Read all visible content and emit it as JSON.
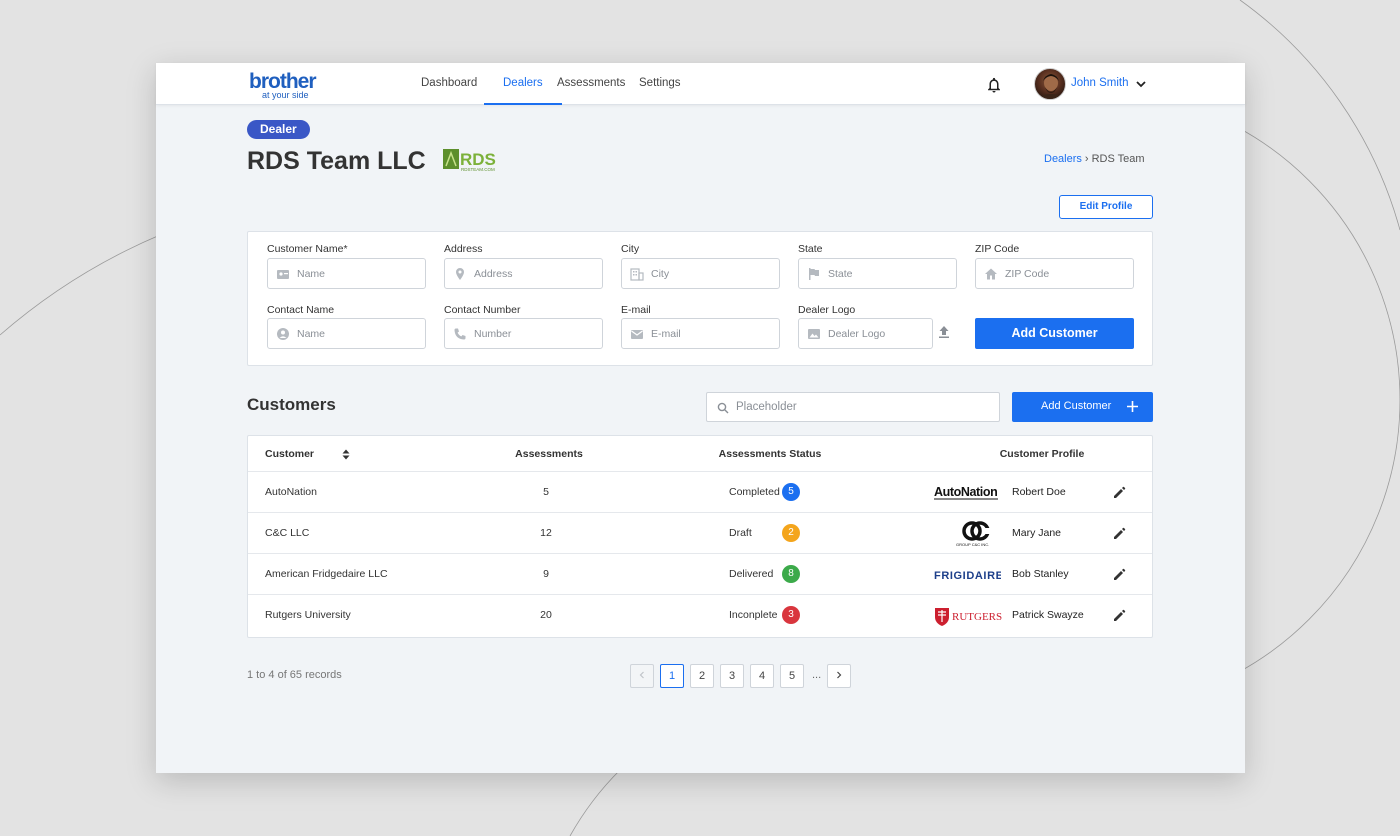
{
  "header": {
    "brand": "brother",
    "tagline": "at your side",
    "nav": [
      {
        "label": "Dashboard",
        "active": false
      },
      {
        "label": "Dealers",
        "active": true
      },
      {
        "label": "Assessments",
        "active": false
      },
      {
        "label": "Settings",
        "active": false
      }
    ],
    "user_name": "John Smith",
    "icons": {
      "notifications": "bell-icon",
      "user_menu": "chevron-down-icon"
    }
  },
  "page": {
    "badge": "Dealer",
    "title": "RDS Team LLC",
    "dealer_logo_text": "RDS",
    "dealer_logo_subtext": "RDSTEAM.COM",
    "breadcrumb": {
      "parent": "Dealers",
      "current": "RDS Team"
    },
    "edit_profile": "Edit Profile"
  },
  "form": {
    "fields": [
      {
        "label": "Customer Name*",
        "placeholder": "Name",
        "icon": "contact-card-icon"
      },
      {
        "label": "Address",
        "placeholder": "Address",
        "icon": "location-pin-icon"
      },
      {
        "label": "City",
        "placeholder": "City",
        "icon": "building-icon"
      },
      {
        "label": "State",
        "placeholder": "State",
        "icon": "flag-icon"
      },
      {
        "label": "ZIP Code",
        "placeholder": "ZIP Code",
        "icon": "home-icon"
      },
      {
        "label": "Contact Name",
        "placeholder": "Name",
        "icon": "person-icon"
      },
      {
        "label": "Contact Number",
        "placeholder": "Number",
        "icon": "phone-icon"
      },
      {
        "label": "E-mail",
        "placeholder": "E-mail",
        "icon": "mail-icon"
      },
      {
        "label": "Dealer Logo",
        "placeholder": "Dealer Logo",
        "icon": "image-icon"
      }
    ],
    "upload_icon": "upload-icon",
    "submit_label": "Add Customer"
  },
  "customers": {
    "title": "Customers",
    "search_placeholder": "Placeholder",
    "add_label": "Add Customer",
    "columns": [
      "Customer",
      "Assessments",
      "Assessments Status",
      "Customer Profile"
    ],
    "rows": [
      {
        "customer": "AutoNation",
        "assessments": "5",
        "status": "Completed",
        "status_count": "5",
        "status_color": "#1b6ff0",
        "logo_text": "AutoNation",
        "profile": "Robert Doe"
      },
      {
        "customer": "C&C LLC",
        "assessments": "12",
        "status": "Draft",
        "status_count": "2",
        "status_color": "#f4a51c",
        "logo_text": "GROUP C&C INC.",
        "profile": "Mary Jane"
      },
      {
        "customer": "American Fridgedaire LLC",
        "assessments": "9",
        "status": "Delivered",
        "status_count": "8",
        "status_color": "#3caa4a",
        "logo_text": "FRIGIDAIRE",
        "profile": "Bob Stanley"
      },
      {
        "customer": "Rutgers University",
        "assessments": "20",
        "status": "Inconplete",
        "status_count": "3",
        "status_color": "#d9363e",
        "logo_text": "RUTGERS",
        "profile": "Patrick Swayze"
      }
    ],
    "records_text": "1 to 4 of 65 records",
    "pages": [
      "1",
      "2",
      "3",
      "4",
      "5"
    ],
    "current_page": "1",
    "ellipsis": "..."
  },
  "colors": {
    "accent": "#1b6ff0",
    "badge": "#3a57c6",
    "brand": "#1f5fbf"
  }
}
